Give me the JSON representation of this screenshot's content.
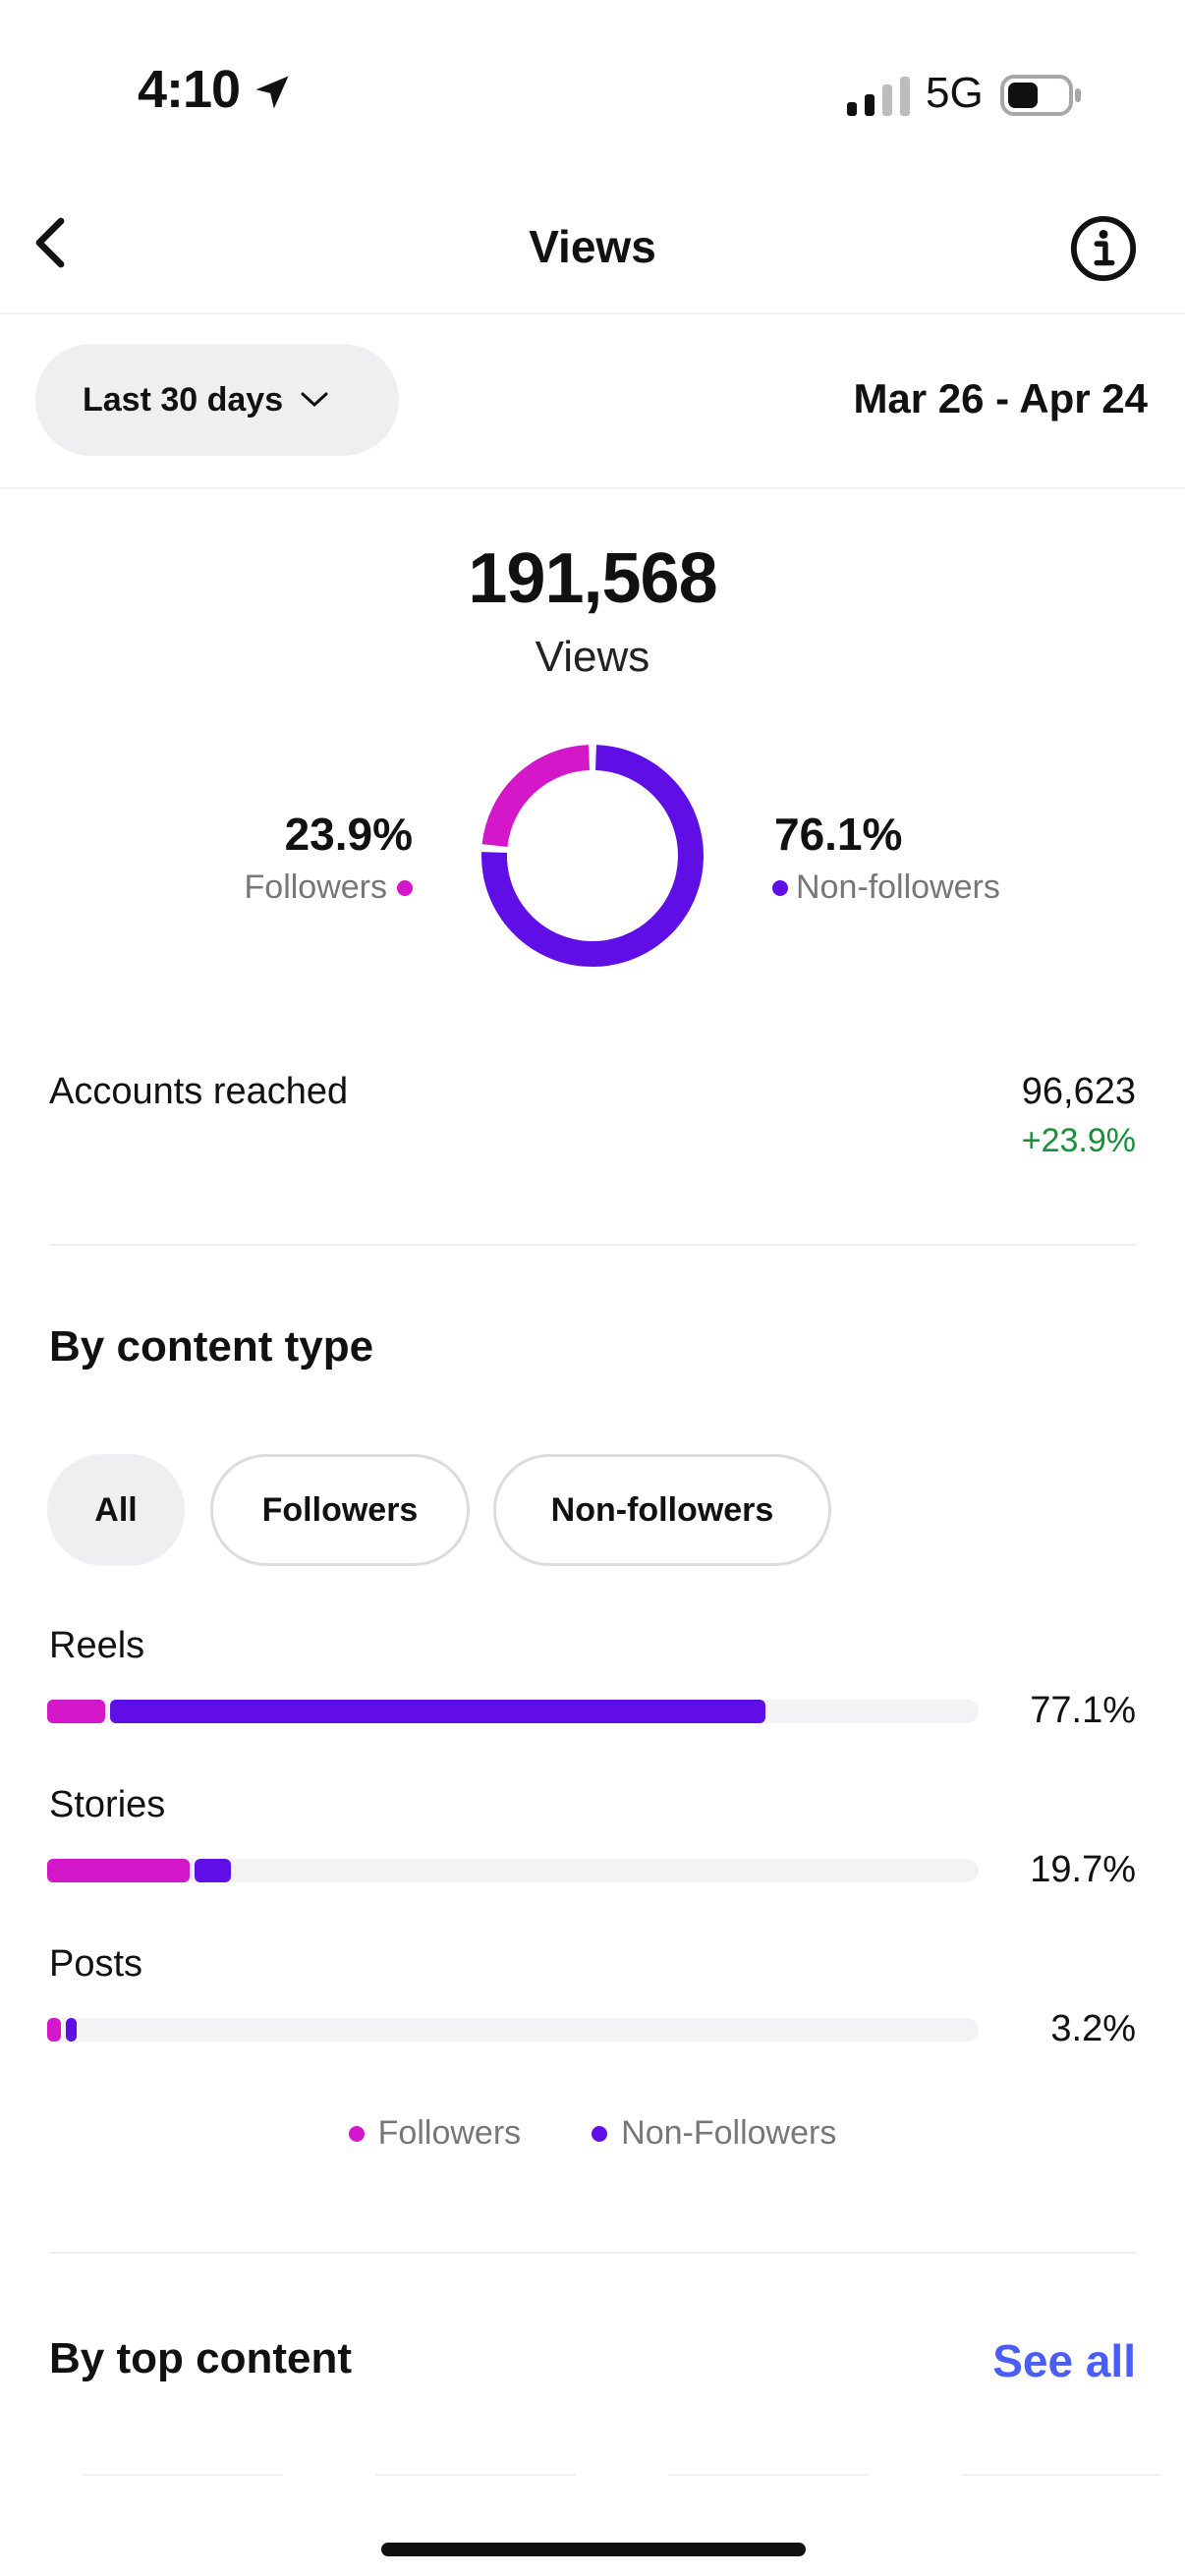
{
  "status_bar": {
    "time": "4:10",
    "network": "5G",
    "location_icon": "location-arrow-icon",
    "signal_icon": "cellular-signal-icon",
    "battery_icon": "battery-icon"
  },
  "header": {
    "title": "Views",
    "back_icon": "chevron-left-icon",
    "info_icon": "info-icon"
  },
  "filter": {
    "range_label": "Last 30 days",
    "date_range": "Mar 26 - Apr 24"
  },
  "summary": {
    "total": "191,568",
    "total_label": "Views",
    "followers_pct": "23.9%",
    "followers_label": "Followers",
    "nonfollowers_pct": "76.1%",
    "nonfollowers_label": "Non-followers",
    "followers_fraction": 0.239,
    "nonfollowers_fraction": 0.761
  },
  "accounts_reached": {
    "label": "Accounts reached",
    "value": "96,623",
    "change": "+23.9%"
  },
  "content_type": {
    "title": "By content type",
    "chips": [
      "All",
      "Followers",
      "Non-followers"
    ],
    "selected_chip": "All",
    "rows": [
      {
        "label": "Reels",
        "pct": "77.1%",
        "followers": 6.5,
        "nonfollowers": 70.6
      },
      {
        "label": "Stories",
        "pct": "19.7%",
        "followers": 15.6,
        "nonfollowers": 4.1
      },
      {
        "label": "Posts",
        "pct": "3.2%",
        "followers": 1.7,
        "nonfollowers": 1.5
      }
    ],
    "legend": [
      "Followers",
      "Non-Followers"
    ]
  },
  "top_content": {
    "title": "By top content",
    "see_all": "See all"
  },
  "colors": {
    "followers": "#d317c9",
    "nonfollowers": "#5f0fe6",
    "positive": "#1a8f3a",
    "link": "#4a5df5"
  }
}
